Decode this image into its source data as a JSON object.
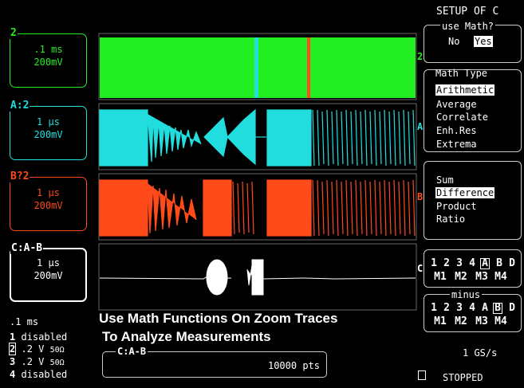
{
  "colors": {
    "green": "#22ee22",
    "cyan": "#22dddd",
    "red": "#ff4a1a",
    "white": "#ffffff",
    "grey": "#aaaaaa"
  },
  "traces": [
    {
      "id": "2",
      "name": "trace-2",
      "label": "2",
      "timebase": ".1 ms",
      "volts": "200mV",
      "marker": "2"
    },
    {
      "id": "A",
      "name": "trace-A",
      "label": "A:2",
      "timebase": "1 μs",
      "volts": "200mV",
      "marker": "A"
    },
    {
      "id": "B",
      "name": "trace-B",
      "label": "B?2",
      "timebase": "1 μs",
      "volts": "200mV",
      "marker": "B"
    },
    {
      "id": "C",
      "name": "trace-C",
      "label": "C:A-B",
      "timebase": "1 μs",
      "volts": "200mV",
      "marker": "C"
    }
  ],
  "channels": {
    "timebase": ".1 ms",
    "rows": [
      {
        "num": "1",
        "status": "disabled",
        "volts": "",
        "ohm": ""
      },
      {
        "num": "2",
        "status": "",
        "volts": ".2  V",
        "ohm": "50Ω"
      },
      {
        "num": "3",
        "status": "",
        "volts": ".2  V",
        "ohm": "50Ω"
      },
      {
        "num": "4",
        "status": "disabled",
        "volts": "",
        "ohm": ""
      }
    ]
  },
  "headline": {
    "line1": "Use Math Functions On Zoom Traces",
    "line2": "To Analyze Measurements"
  },
  "bottom": {
    "trace": "C:A-B",
    "points": "10000 pts"
  },
  "menu": {
    "title": "SETUP OF C",
    "use_math": {
      "title": "use Math?",
      "no": "No",
      "yes": "Yes",
      "selected": "Yes"
    },
    "math_type": {
      "title": "Math Type",
      "items": [
        "Arithmetic",
        "Average",
        "Correlate",
        "Enh.Res",
        "Extrema"
      ],
      "selected": "Arithmetic"
    },
    "operation": {
      "items": [
        "Sum",
        "Difference",
        "Product",
        "Ratio"
      ],
      "selected": "Difference"
    },
    "source1": {
      "top": [
        "1",
        "2",
        "3",
        "4",
        "A",
        "B",
        "D"
      ],
      "bottom": [
        "M1",
        "M2",
        "M3",
        "M4"
      ],
      "selected": "A"
    },
    "minus": {
      "title": "minus",
      "top": [
        "1",
        "2",
        "3",
        "4",
        "A",
        "B",
        "D"
      ],
      "bottom": [
        "M1",
        "M2",
        "M3",
        "M4"
      ],
      "selected": "B"
    },
    "sample_rate": "1 GS/s",
    "status": "STOPPED"
  }
}
